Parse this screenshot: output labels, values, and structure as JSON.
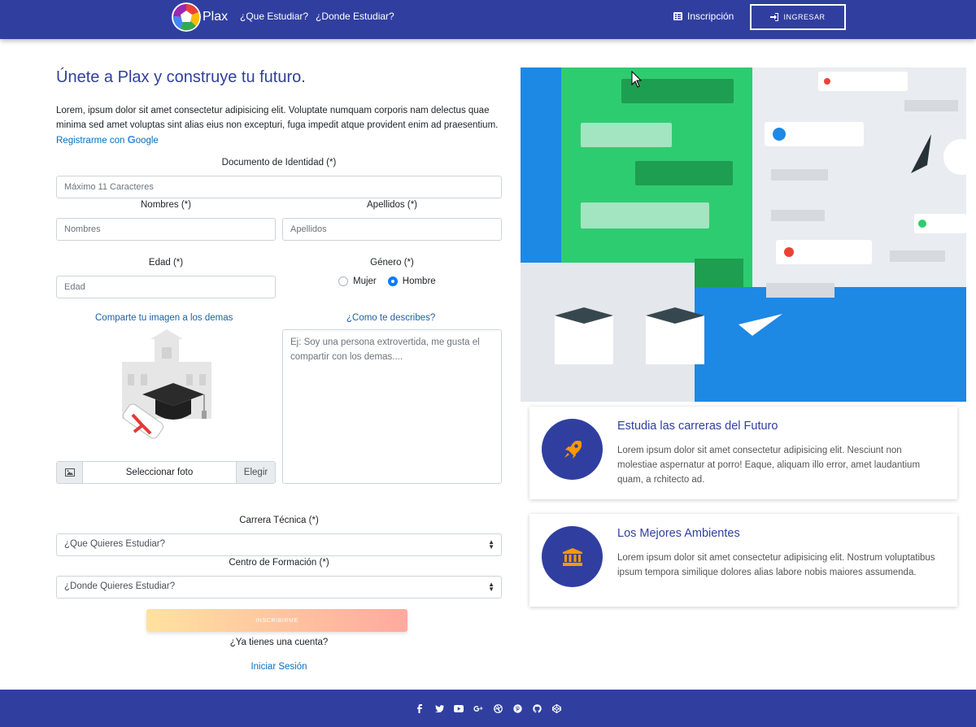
{
  "navbar": {
    "brand": "Plax",
    "links": [
      "¿Que Estudiar?",
      "¿Donde Estudiar?"
    ],
    "inscripcion": "Inscripción",
    "ingresar": "INGRESAR"
  },
  "form": {
    "title": "Únete a Plax y construye tu futuro.",
    "lead": "Lorem, ipsum dolor sit amet consectetur adipisicing elit. Voluptate numquam corporis nam delectus quae minima sed amet voluptas sint alias eius non excepturi, fuga impedit atque provident enim ad praesentium.",
    "google_link_prefix": "Registrarme con ",
    "google_link_brand_g": "G",
    "google_link_brand_rest": "oogle",
    "documento_label": "Documento de Identidad (*)",
    "documento_placeholder": "Máximo 11 Caracteres",
    "nombres_label": "Nombres (*)",
    "nombres_placeholder": "Nombres",
    "apellidos_label": "Apellidos (*)",
    "apellidos_placeholder": "Apellidos",
    "edad_label": "Edad (*)",
    "edad_placeholder": "Edad",
    "genero_label": "Género (*)",
    "genero_options": [
      "Mujer",
      "Hombre"
    ],
    "genero_selected": "Hombre",
    "imagen_label": "Comparte tu imagen a los demas",
    "file_text": "Seleccionar foto",
    "file_button": "Elegir",
    "describe_label": "¿Como te describes?",
    "describe_placeholder": "Ej: Soy una persona extrovertida, me gusta el compartir con los demas....",
    "carrera_label": "Carrera Técnica (*)",
    "carrera_value": "¿Que Quieres Estudiar?",
    "centro_label": "Centro de Formación (*)",
    "centro_value": "¿Donde Quieres Estudiar?",
    "submit": "INSCRIBIRME",
    "have_account": "¿Ya tienes una cuenta?",
    "login_link": "Iniciar Sesión"
  },
  "cards": [
    {
      "title": "Estudia las carreras del Futuro",
      "text": "Lorem ipsum dolor sit amet consectetur adipisicing elit. Nesciunt non molestiae aspernatur at porro! Eaque, aliquam illo error, amet laudantium quam, a rchitecto ad.",
      "icon": "rocket-icon"
    },
    {
      "title": "Los Mejores Ambientes",
      "text": "Lorem ipsum dolor sit amet consectetur adipisicing elit. Nostrum voluptatibus ipsum tempora similique dolores alias labore nobis maiores assumenda.",
      "icon": "university-icon"
    }
  ],
  "footer": {
    "social_icons": [
      "facebook-icon",
      "twitter-icon",
      "youtube-icon",
      "google-plus-icon",
      "dribbble-icon",
      "pinterest-icon",
      "github-icon",
      "codepen-icon"
    ]
  },
  "colors": {
    "primary": "#303f9f",
    "link": "#0d6fb8",
    "accent_orange": "#ff9800"
  }
}
